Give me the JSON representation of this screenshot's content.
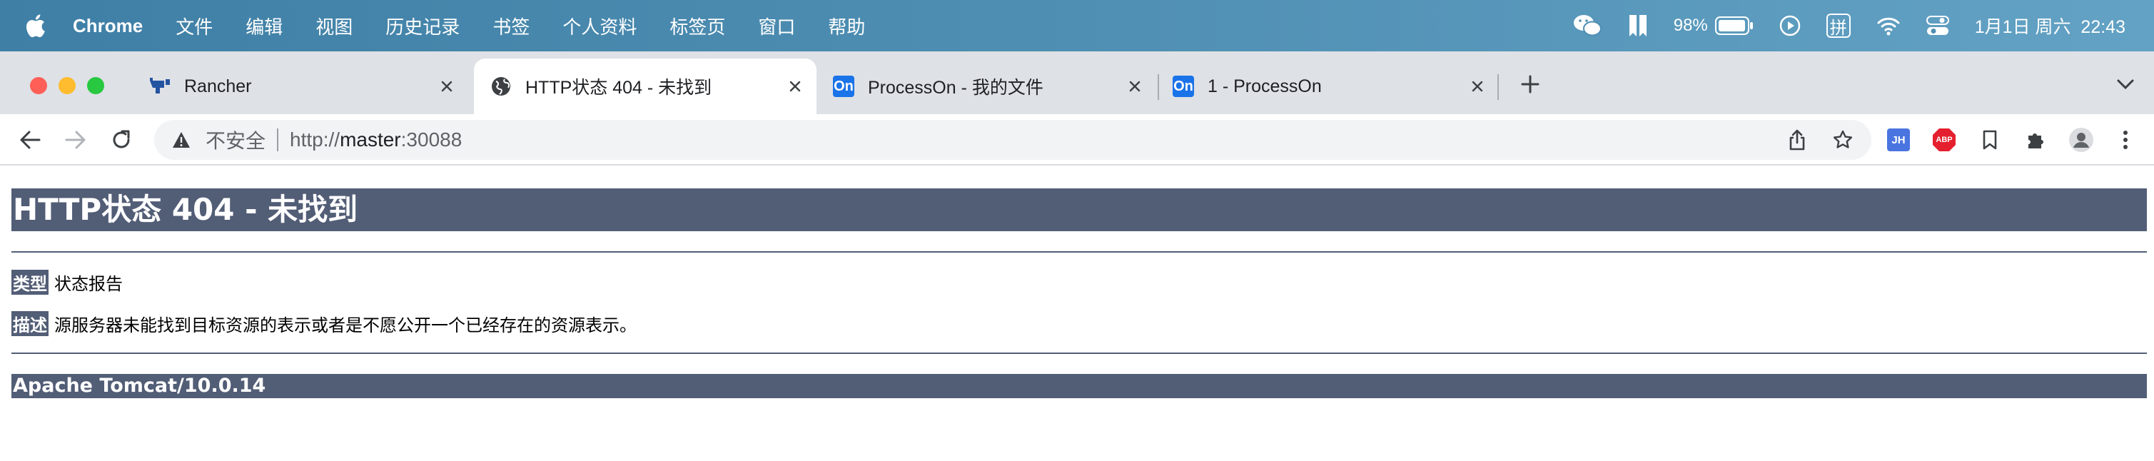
{
  "menubar": {
    "app_name": "Chrome",
    "items": [
      "文件",
      "编辑",
      "视图",
      "历史记录",
      "书签",
      "个人资料",
      "标签页",
      "窗口",
      "帮助"
    ],
    "battery": "98%",
    "ime": "拼",
    "datetime": "1月1日 周六  22:43"
  },
  "tabs": [
    {
      "title": "Rancher",
      "icon": "rancher-icon"
    },
    {
      "title": "HTTP状态 404 - 未找到",
      "icon": "globe-icon",
      "active": true
    },
    {
      "title": "ProcessOn - 我的文件",
      "icon": "processon-icon",
      "badge": "On"
    },
    {
      "title": "1 - ProcessOn",
      "icon": "processon-icon",
      "badge": "On"
    }
  ],
  "omnibox": {
    "security_label": "不安全",
    "url_scheme": "http://",
    "url_host": "master",
    "url_rest": ":30088"
  },
  "extensions": {
    "jh_label": "JH",
    "abp_label": "ABP"
  },
  "page": {
    "heading": "HTTP状态 404 - 未找到",
    "type_label": "类型",
    "type_value": "状态报告",
    "desc_label": "描述",
    "desc_value": "源服务器未能找到目标资源的表示或者是不愿公开一个已经存在的资源表示。",
    "footer": "Apache Tomcat/10.0.14"
  },
  "colors": {
    "tomcat_banner": "#525d76",
    "tab_strip": "#dee1e6",
    "close": "#ff5f57",
    "minimize": "#febc2e",
    "zoom": "#28c840"
  }
}
